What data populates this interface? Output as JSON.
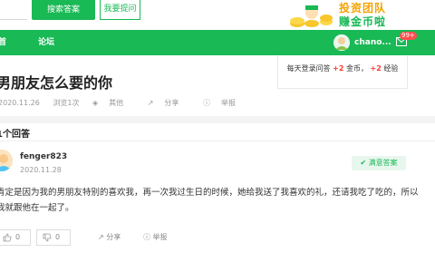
{
  "header": {
    "search_button": "搜索答案",
    "ask_button": "我要提问",
    "banner_line1": "投资团队",
    "banner_line2": "赚金币啦"
  },
  "nav": {
    "item_first": "首",
    "item_forum": "论坛",
    "username": "chano...",
    "badge": "99+"
  },
  "question": {
    "title": "男朋友怎么要的你",
    "date": "2020.11.26",
    "views": "浏览1次",
    "other": "其他",
    "share": "分享",
    "report": "举报"
  },
  "ad": {
    "text1": "每天登录问答",
    "plus1": "+2",
    "text2": "金币，",
    "plus2": "+2",
    "text3": "经验"
  },
  "answers": {
    "count_label": "1个回答",
    "items": [
      {
        "name": "fenger823",
        "date": "2020.11.28",
        "satisfied": "满意答案",
        "text": "肯定是因为我的男朋友特别的喜欢我，再一次我过生日的时候，她给我送了我喜欢的礼，还请我吃了吃的，所以我就跟他在一起了。",
        "likes": "0",
        "dislikes": "0",
        "share": "分享",
        "report": "举报"
      }
    ]
  },
  "colors": {
    "brand_green": "#19b955",
    "accent_red": "#ff3b30",
    "banner_orange": "#f5a300"
  }
}
